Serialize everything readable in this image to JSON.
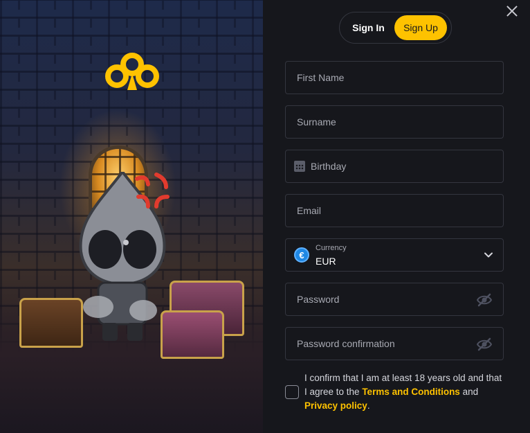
{
  "tabs": {
    "signin": "Sign In",
    "signup": "Sign Up"
  },
  "form": {
    "first_name": "First Name",
    "surname": "Surname",
    "birthday": "Birthday",
    "email": "Email",
    "currency": {
      "label": "Currency",
      "value": "EUR",
      "symbol": "€"
    },
    "password": "Password",
    "password_confirmation": "Password confirmation"
  },
  "consent": {
    "text_before": "I confirm that I am at least 18 years old and that I agree to the ",
    "terms": "Terms and Conditions",
    "and": " and ",
    "privacy": "Privacy policy",
    "end": "."
  },
  "colors": {
    "accent": "#fec200",
    "background": "#16171c",
    "border": "#34363f"
  },
  "icons": [
    "close-icon",
    "calendar-icon",
    "euro-icon",
    "chevron-down-icon",
    "eye-off-icon",
    "club-logo-icon"
  ]
}
